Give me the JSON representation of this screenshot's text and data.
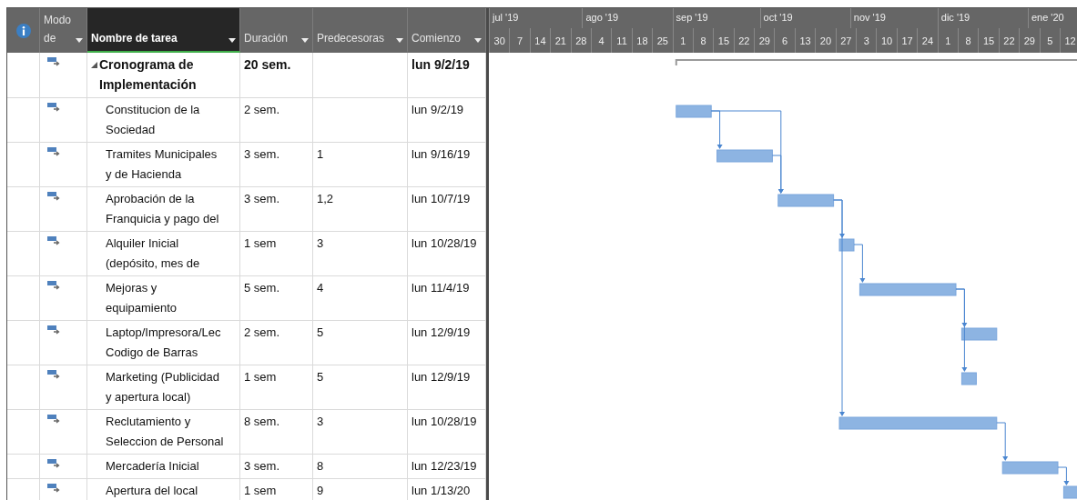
{
  "columns": [
    {
      "label": "Modo de",
      "selected": false
    },
    {
      "label": "Nombre de tarea",
      "selected": true
    },
    {
      "label": "Duración",
      "selected": false
    },
    {
      "label": "Predecesoras",
      "selected": false
    },
    {
      "label": "Comienzo",
      "selected": false
    }
  ],
  "timescale": {
    "months": [
      "jul '19",
      "ago '19",
      "sep '19",
      "oct '19",
      "nov '19",
      "dic '19",
      "ene '20"
    ],
    "weeks": [
      "30",
      "7",
      "14",
      "21",
      "28",
      "4",
      "11",
      "18",
      "25",
      "1",
      "8",
      "15",
      "22",
      "29",
      "6",
      "13",
      "20",
      "27",
      "3",
      "10",
      "17",
      "24",
      "1",
      "8",
      "15",
      "22",
      "29",
      "5",
      "12"
    ]
  },
  "tasks": [
    {
      "kind": "summary",
      "expanded": true,
      "name": [
        "Cronograma de",
        "Implementación"
      ],
      "duration": "20 sem.",
      "start": "lun 9/2/19"
    },
    {
      "kind": "task",
      "name": [
        "Constitucion de la",
        "Sociedad"
      ],
      "duration": "2 sem.",
      "start": "lun 9/2/19"
    },
    {
      "kind": "task",
      "name": [
        "Tramites Municipales",
        "y de Hacienda"
      ],
      "duration": "3 sem.",
      "predecessors": "1",
      "start": "lun 9/16/19"
    },
    {
      "kind": "task",
      "name": [
        "Aprobación de la",
        "Franquicia y pago del"
      ],
      "duration": "3 sem.",
      "predecessors": "1,2",
      "start": "lun 10/7/19"
    },
    {
      "kind": "task",
      "name": [
        "Alquiler Inicial",
        "(depósito, mes de"
      ],
      "duration": "1 sem",
      "predecessors": "3",
      "start": "lun 10/28/19"
    },
    {
      "kind": "task",
      "name": [
        "Mejoras y",
        "equipamiento"
      ],
      "duration": "5 sem.",
      "predecessors": "4",
      "start": "lun 11/4/19"
    },
    {
      "kind": "task",
      "name": [
        "Laptop/Impresora/Lec",
        "Codigo de Barras"
      ],
      "duration": "2 sem.",
      "predecessors": "5",
      "start": "lun 12/9/19"
    },
    {
      "kind": "task",
      "name": [
        "Marketing (Publicidad",
        "y apertura local)"
      ],
      "duration": "1 sem",
      "predecessors": "5",
      "start": "lun 12/9/19"
    },
    {
      "kind": "task",
      "name": [
        "Reclutamiento y",
        "Seleccion de Personal"
      ],
      "duration": "8 sem.",
      "predecessors": "3",
      "start": "lun 10/28/19"
    },
    {
      "kind": "task",
      "name": [
        "Mercadería Inicial"
      ],
      "duration": "3 sem.",
      "predecessors": "8",
      "start": "lun 12/23/19"
    },
    {
      "kind": "task",
      "name": [
        "Apertura del local"
      ],
      "duration": "1 sem",
      "predecessors": "9",
      "start": "lun 1/13/20"
    }
  ]
}
